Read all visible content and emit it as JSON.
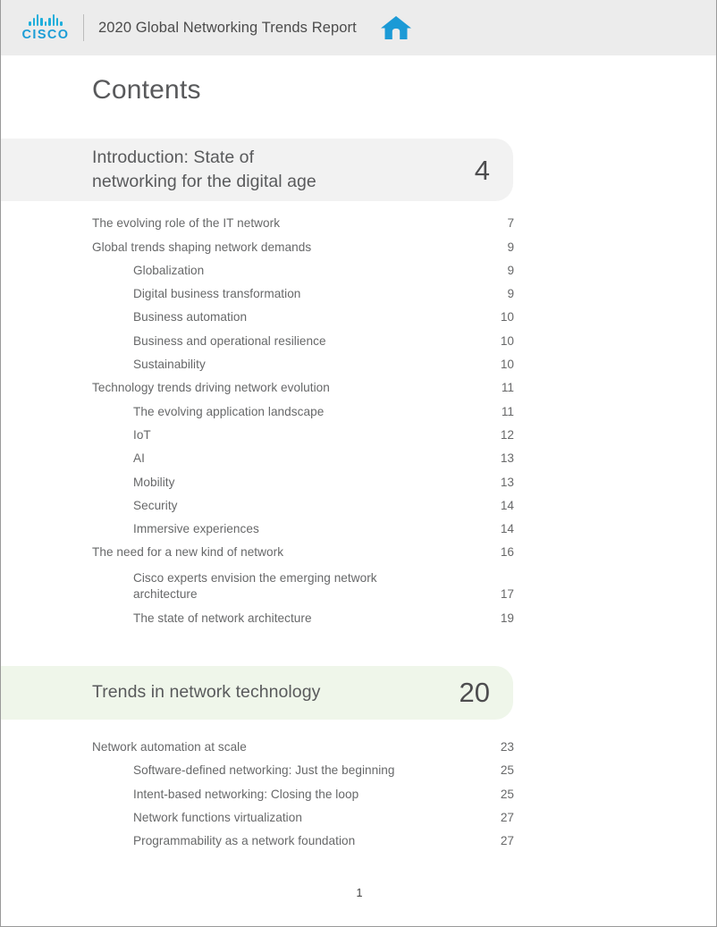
{
  "header": {
    "brand": "CISCO",
    "brand_logo_icon": "cisco-bars-logo",
    "title": "2020 Global Networking Trends Report",
    "home_icon": "home-icon",
    "accent_color": "#1c9dd6",
    "background_color": "#ececec"
  },
  "page": {
    "heading": "Contents",
    "footer_page_number": "1"
  },
  "sections": [
    {
      "title_line1": "Introduction: State of",
      "title_line2": "networking for the digital age",
      "page": "4",
      "band_color": "#f2f2f2",
      "entries": [
        {
          "level": 1,
          "label": "The evolving role of the IT network",
          "page": "7"
        },
        {
          "level": 1,
          "label": "Global trends shaping network demands",
          "page": "9"
        },
        {
          "level": 2,
          "label": "Globalization",
          "page": "9"
        },
        {
          "level": 2,
          "label": "Digital business transformation",
          "page": "9"
        },
        {
          "level": 2,
          "label": "Business automation",
          "page": "10"
        },
        {
          "level": 2,
          "label": "Business and operational resilience",
          "page": "10"
        },
        {
          "level": 2,
          "label": "Sustainability",
          "page": "10"
        },
        {
          "level": 1,
          "label": "Technology trends driving network evolution",
          "page": "11"
        },
        {
          "level": 2,
          "label": "The evolving application landscape",
          "page": "11"
        },
        {
          "level": 2,
          "label": "IoT",
          "page": "12"
        },
        {
          "level": 2,
          "label": "AI",
          "page": "13"
        },
        {
          "level": 2,
          "label": "Mobility",
          "page": "13"
        },
        {
          "level": 2,
          "label": "Security",
          "page": "14"
        },
        {
          "level": 2,
          "label": "Immersive experiences",
          "page": "14"
        },
        {
          "level": 1,
          "label": "The need for a new kind of network",
          "page": "16"
        },
        {
          "level": 2,
          "label": "Cisco experts envision the emerging network architecture",
          "page": "17"
        },
        {
          "level": 2,
          "label": "The state of network architecture",
          "page": "19"
        }
      ]
    },
    {
      "title_line1": "Trends in network technology",
      "title_line2": "",
      "page": "20",
      "band_color": "#eff6ea",
      "entries": [
        {
          "level": 1,
          "label": "Network automation at scale",
          "page": "23"
        },
        {
          "level": 2,
          "label": "Software-defined networking: Just the beginning",
          "page": "25"
        },
        {
          "level": 2,
          "label": "Intent-based networking: Closing the loop",
          "page": "25"
        },
        {
          "level": 2,
          "label": "Network functions virtualization",
          "page": "27"
        },
        {
          "level": 2,
          "label": "Programmability as a network foundation",
          "page": "27"
        }
      ]
    }
  ]
}
